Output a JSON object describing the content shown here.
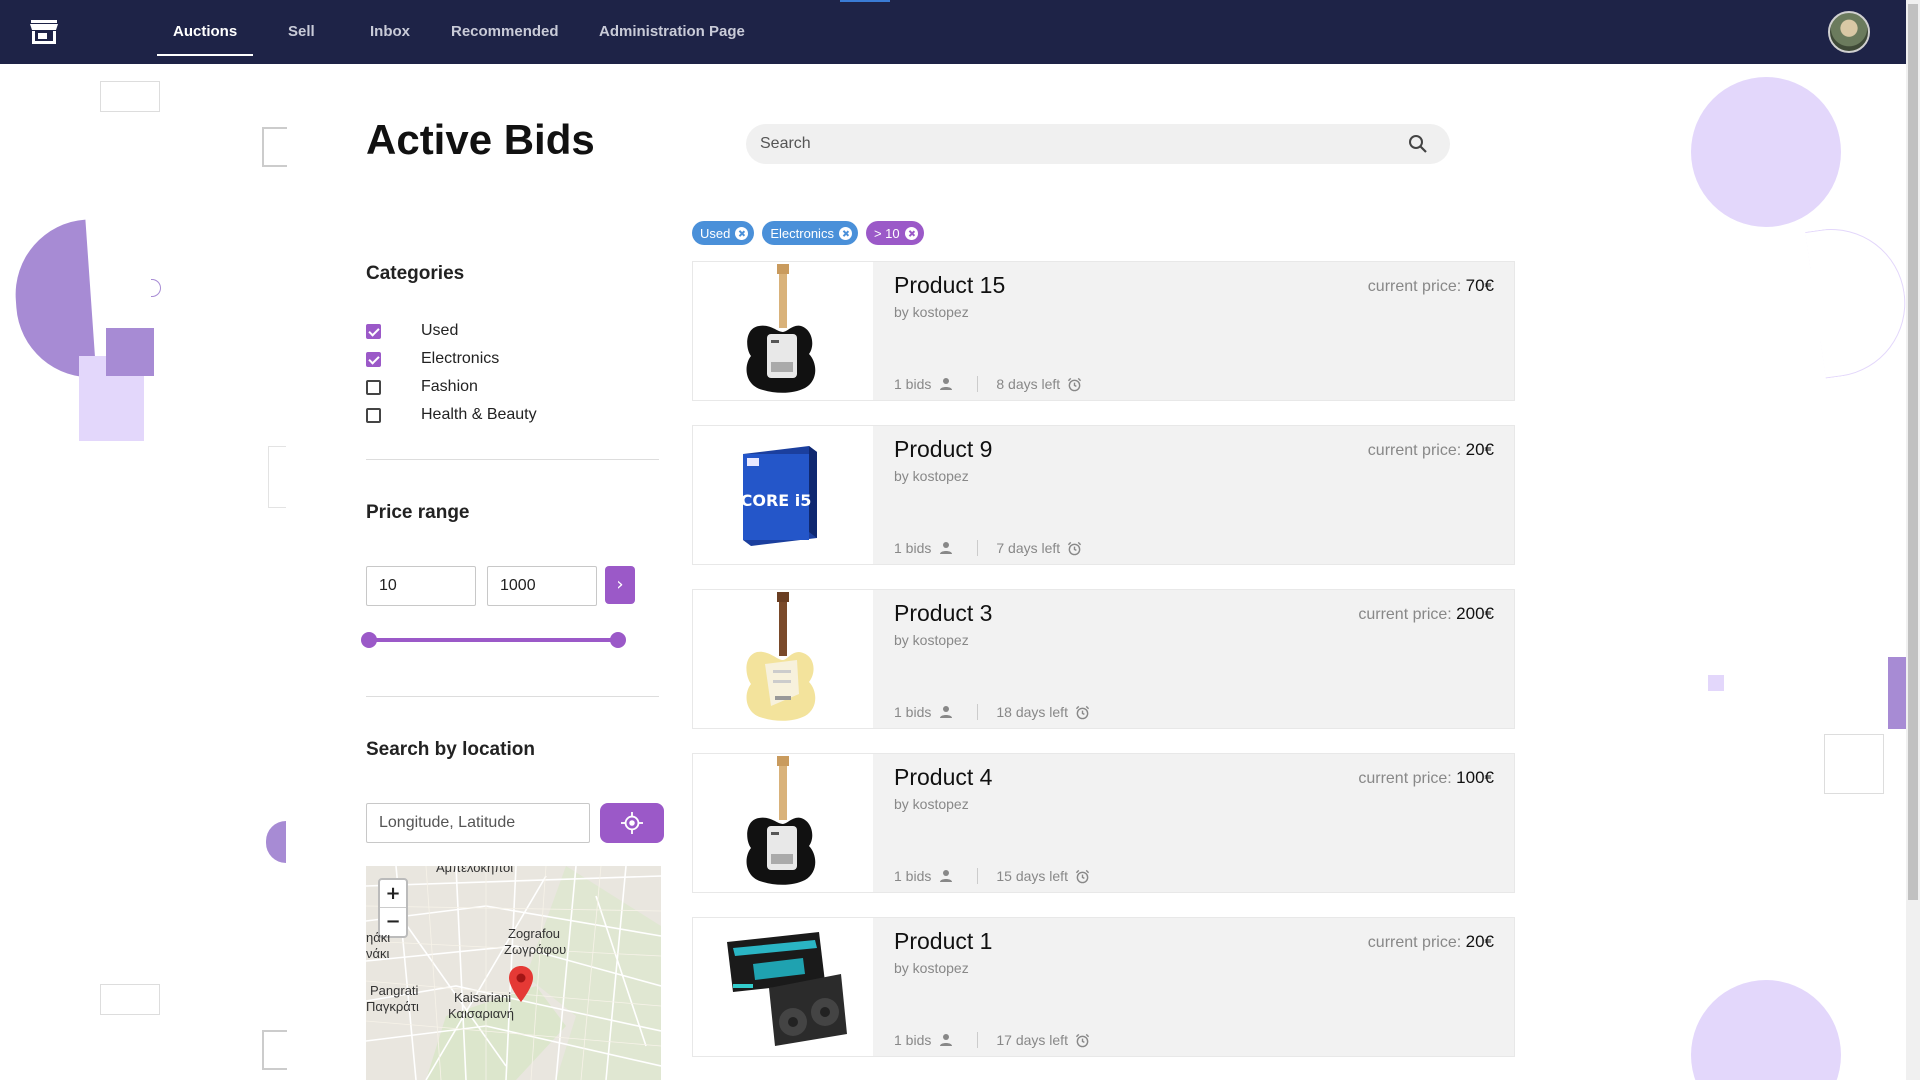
{
  "nav": {
    "logo_icon": "store-icon",
    "tabs": [
      {
        "label": "Auctions",
        "active": true
      },
      {
        "label": "Sell",
        "active": false
      },
      {
        "label": "Inbox",
        "active": false
      },
      {
        "label": "Recommended",
        "active": false
      },
      {
        "label": "Administration Page",
        "active": false
      }
    ],
    "avatar_icon": "user-avatar"
  },
  "page": {
    "title": "Active Bids"
  },
  "search": {
    "placeholder": "Search",
    "icon": "search-icon"
  },
  "filters": {
    "categories_title": "Categories",
    "categories": [
      {
        "label": "Used",
        "checked": true
      },
      {
        "label": "Electronics",
        "checked": true
      },
      {
        "label": "Fashion",
        "checked": false
      },
      {
        "label": "Health & Beauty",
        "checked": false
      }
    ],
    "price_title": "Price range",
    "price_min": "10",
    "price_max": "1000",
    "price_go_label": "›",
    "location_title": "Search by location",
    "location_placeholder": "Longitude, Latitude",
    "location_icon": "crosshair-icon"
  },
  "map": {
    "zoom_in": "+",
    "zoom_out": "−",
    "labels": [
      "Αμπελόκηποι",
      "Zografou",
      "Ζωγράφου",
      "Pangrati",
      "Παγκράτι",
      "Kaisariani",
      "Καισαριανή",
      "ηάκι",
      "νάκι"
    ]
  },
  "chips": [
    {
      "label": "Used",
      "color": "#4a90d9"
    },
    {
      "label": "Electronics",
      "color": "#4a90d9"
    },
    {
      "label": "> 10",
      "color": "#9b59c8"
    }
  ],
  "products": [
    {
      "name": "Product 15",
      "seller": "by kostopez",
      "price_label": "current price:",
      "price": "70€",
      "bids": "1 bids",
      "time_left": "8 days left",
      "image": "black-guitar"
    },
    {
      "name": "Product 9",
      "seller": "by kostopez",
      "price_label": "current price:",
      "price": "20€",
      "bids": "1 bids",
      "time_left": "7 days left",
      "image": "cpu-box"
    },
    {
      "name": "Product 3",
      "seller": "by kostopez",
      "price_label": "current price:",
      "price": "200€",
      "bids": "1 bids",
      "time_left": "18 days left",
      "image": "cream-guitar"
    },
    {
      "name": "Product 4",
      "seller": "by kostopez",
      "price_label": "current price:",
      "price": "100€",
      "bids": "1 bids",
      "time_left": "15 days left",
      "image": "black-guitar"
    },
    {
      "name": "Product 1",
      "seller": "by kostopez",
      "price_label": "current price:",
      "price": "20€",
      "bids": "1 bids",
      "time_left": "17 days left",
      "image": "graphics-card"
    }
  ],
  "cpu_box_text": "CORE i5",
  "colors": {
    "nav_bg": "#1e2347",
    "accent": "#9b59c8",
    "chip_blue": "#4a90d9",
    "deco_purple": "#e3d7fb"
  }
}
